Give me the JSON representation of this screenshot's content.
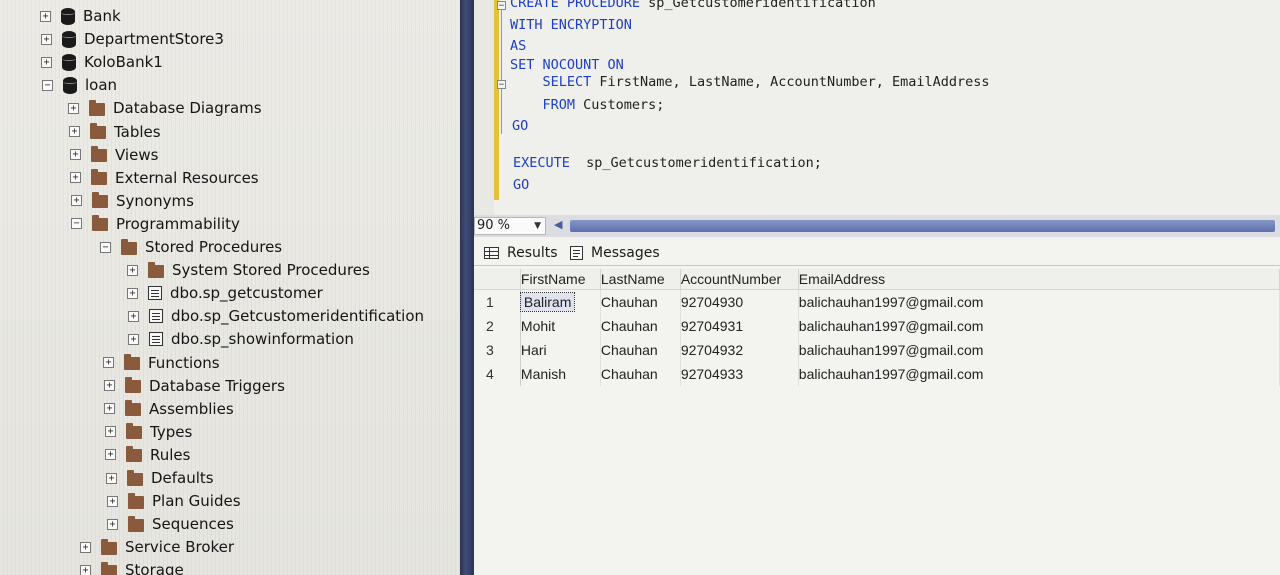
{
  "explorer": {
    "items": [
      {
        "label": "Bank",
        "icon": "database-icon",
        "toggle": "+",
        "level": 0
      },
      {
        "label": "DepartmentStore3",
        "icon": "database-icon",
        "toggle": "+",
        "level": 0
      },
      {
        "label": "KoloBank1",
        "icon": "database-icon",
        "toggle": "+",
        "level": 0
      },
      {
        "label": "loan",
        "icon": "database-icon",
        "toggle": "−",
        "level": 0
      },
      {
        "label": "Database Diagrams",
        "icon": "folder-icon",
        "toggle": "+",
        "level": 1
      },
      {
        "label": "Tables",
        "icon": "folder-icon",
        "toggle": "+",
        "level": 1
      },
      {
        "label": "Views",
        "icon": "folder-icon",
        "toggle": "+",
        "level": 1
      },
      {
        "label": "External Resources",
        "icon": "folder-icon",
        "toggle": "+",
        "level": 1
      },
      {
        "label": "Synonyms",
        "icon": "folder-icon",
        "toggle": "+",
        "level": 1
      },
      {
        "label": "Programmability",
        "icon": "folder-icon",
        "toggle": "−",
        "level": 1
      },
      {
        "label": "Stored Procedures",
        "icon": "folder-icon",
        "toggle": "−",
        "level": 2
      },
      {
        "label": "System Stored Procedures",
        "icon": "folder-icon",
        "toggle": "+",
        "level": 3
      },
      {
        "label": "dbo.sp_getcustomer",
        "icon": "stored-procedure-icon",
        "toggle": "+",
        "level": 3
      },
      {
        "label": "dbo.sp_Getcustomeridentification",
        "icon": "stored-procedure-icon",
        "toggle": "+",
        "level": 3
      },
      {
        "label": "dbo.sp_showinformation",
        "icon": "stored-procedure-icon",
        "toggle": "+",
        "level": 3
      },
      {
        "label": "Functions",
        "icon": "folder-icon",
        "toggle": "+",
        "level": 2
      },
      {
        "label": "Database Triggers",
        "icon": "folder-icon",
        "toggle": "+",
        "level": 2
      },
      {
        "label": "Assemblies",
        "icon": "folder-icon",
        "toggle": "+",
        "level": 2
      },
      {
        "label": "Types",
        "icon": "folder-icon",
        "toggle": "+",
        "level": 2
      },
      {
        "label": "Rules",
        "icon": "folder-icon",
        "toggle": "+",
        "level": 2
      },
      {
        "label": "Defaults",
        "icon": "folder-icon",
        "toggle": "+",
        "level": 2
      },
      {
        "label": "Plan Guides",
        "icon": "folder-icon",
        "toggle": "+",
        "level": 2
      },
      {
        "label": "Sequences",
        "icon": "folder-icon",
        "toggle": "+",
        "level": 2
      },
      {
        "label": "Service Broker",
        "icon": "folder-icon",
        "toggle": "+",
        "level": 1
      },
      {
        "label": "Storage",
        "icon": "folder-icon",
        "toggle": "+",
        "level": 1
      }
    ]
  },
  "editor": {
    "lines": [
      [
        {
          "t": "CREATE PROCEDURE",
          "k": true
        },
        {
          "t": " sp_Getcustomeridentification",
          "k": false
        }
      ],
      [
        {
          "t": "WITH ENCRYPTION",
          "k": true
        }
      ],
      [
        {
          "t": "AS",
          "k": true
        }
      ],
      [
        {
          "t": "SET NOCOUNT ON",
          "k": true
        }
      ],
      [
        {
          "t": "    SELECT",
          "k": true
        },
        {
          "t": " FirstName, LastName, AccountNumber, EmailAddress",
          "k": false
        }
      ],
      [
        {
          "t": "    FROM",
          "k": true
        },
        {
          "t": " Customers;",
          "k": false
        }
      ],
      [
        {
          "t": "GO",
          "k": true
        }
      ],
      [
        {
          "t": "",
          "k": false
        }
      ],
      [
        {
          "t": "EXECUTE",
          "k": true
        },
        {
          "t": "  sp_Getcustomeridentification;",
          "k": false
        }
      ],
      [
        {
          "t": "GO",
          "k": true
        }
      ]
    ]
  },
  "zoom": {
    "value": "90 %"
  },
  "results": {
    "tabs": {
      "results": "Results",
      "messages": "Messages"
    },
    "columns": [
      "FirstName",
      "LastName",
      "AccountNumber",
      "EmailAddress"
    ],
    "rows": [
      {
        "num": "1",
        "first": "Baliram",
        "last": "Chauhan",
        "acct": "92704930",
        "email": "balichauhan1997@gmail.com"
      },
      {
        "num": "2",
        "first": "Mohit",
        "last": "Chauhan",
        "acct": "92704931",
        "email": "balichauhan1997@gmail.com"
      },
      {
        "num": "3",
        "first": "Hari",
        "last": "Chauhan",
        "acct": "92704932",
        "email": "balichauhan1997@gmail.com"
      },
      {
        "num": "4",
        "first": "Manish",
        "last": "Chauhan",
        "acct": "92704933",
        "email": "balichauhan1997@gmail.com"
      }
    ]
  },
  "colors": {
    "keyword": "#1f3ec8",
    "change_bar": "#e3c23a",
    "divider": "#2a3350"
  }
}
